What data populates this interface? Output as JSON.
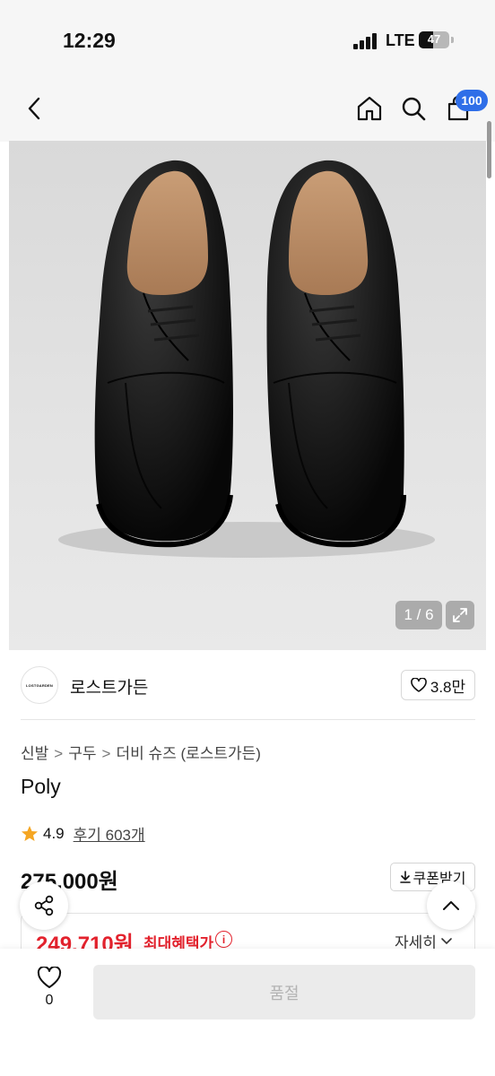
{
  "status_bar": {
    "time": "12:29",
    "network": "LTE",
    "battery": "47"
  },
  "nav": {
    "back_icon": "chevron-left-icon",
    "home_icon": "home-icon",
    "search_icon": "search-icon",
    "cart_icon": "shopping-bag-icon",
    "cart_count": "100"
  },
  "product_image": {
    "counter": "1 / 6",
    "expand_icon": "expand-icon"
  },
  "brand": {
    "logo_text": "LOSTGARDEN",
    "name": "로스트가든",
    "like_count": "3.8만"
  },
  "breadcrumb": [
    "신발",
    "구두",
    "더비 슈즈 (로스트가든)"
  ],
  "product": {
    "name": "Poly",
    "rating": "4.9",
    "reviews": "후기 603개",
    "price": "275,000원",
    "coupon_label": "쿠폰받기",
    "sale_price": "249,710원",
    "benefit_label": "최대혜택가",
    "detail_label": "자세히"
  },
  "bottom": {
    "wish_count": "0",
    "soldout_label": "품절"
  },
  "colors": {
    "accent_red": "#e3222d",
    "badge_blue": "#2f6ee8",
    "star": "#f5a623"
  }
}
